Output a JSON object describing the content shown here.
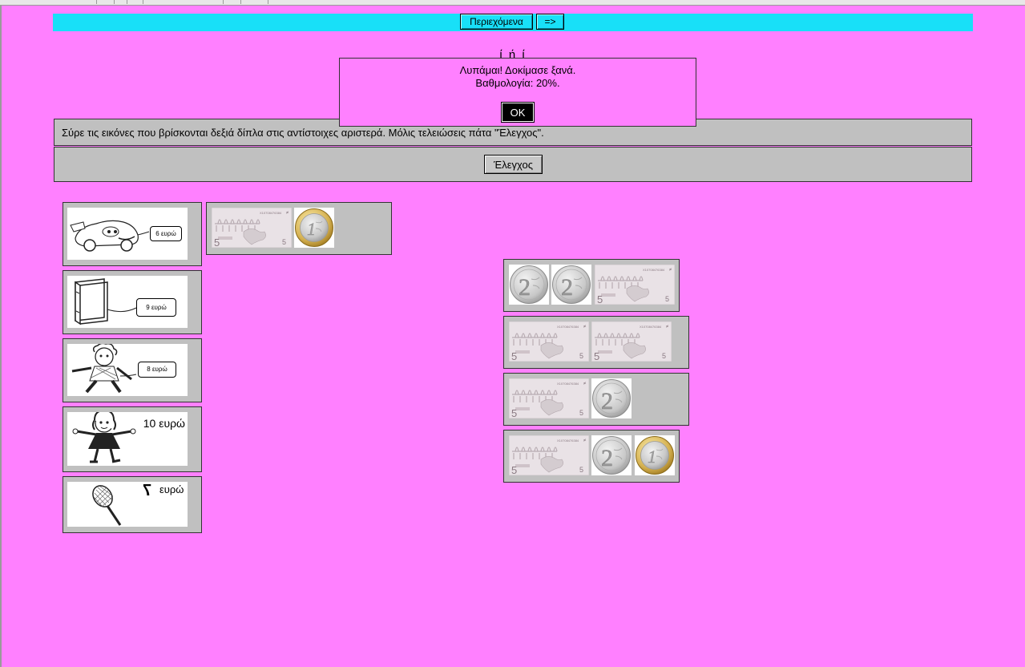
{
  "nav": {
    "contents_label": "Περιεχόμενα",
    "next_label": "=>"
  },
  "title_partial": "ί                    ή                ί",
  "instructions": "Σύρε τις εικόνες που βρίσκονται δεξιά δίπλα στις αντίστοιχες αριστερά. Μόλις τελειώσεις πάτα \"Έλεγχος\".",
  "check_label": "Έλεγχος",
  "dialog": {
    "line1": "Λυπάμαι! Δοκίμασε ξανά.",
    "line2": "Βαθμολογία: 20%.",
    "ok_label": "OK"
  },
  "items": [
    {
      "name": "car",
      "price": "6 ευρώ"
    },
    {
      "name": "book",
      "price": "9 ευρώ"
    },
    {
      "name": "ragdoll",
      "price": "8 ευρώ"
    },
    {
      "name": "girl-doll",
      "price": "10 ευρώ"
    },
    {
      "name": "racket",
      "price_num": "7",
      "price_unit": "ευρώ"
    }
  ],
  "money_groups": [
    {
      "items": [
        "note-5",
        "coin-1"
      ]
    },
    {
      "items": [
        "coin-2",
        "coin-2",
        "note-5"
      ]
    },
    {
      "items": [
        "note-5",
        "note-5"
      ]
    },
    {
      "items": [
        "note-5",
        "coin-2"
      ]
    },
    {
      "items": [
        "note-5",
        "coin-2",
        "coin-1"
      ]
    }
  ],
  "note_denomination": "5",
  "note_serial": "X10708476384",
  "coin1_label": "1",
  "coin2_label": "2"
}
